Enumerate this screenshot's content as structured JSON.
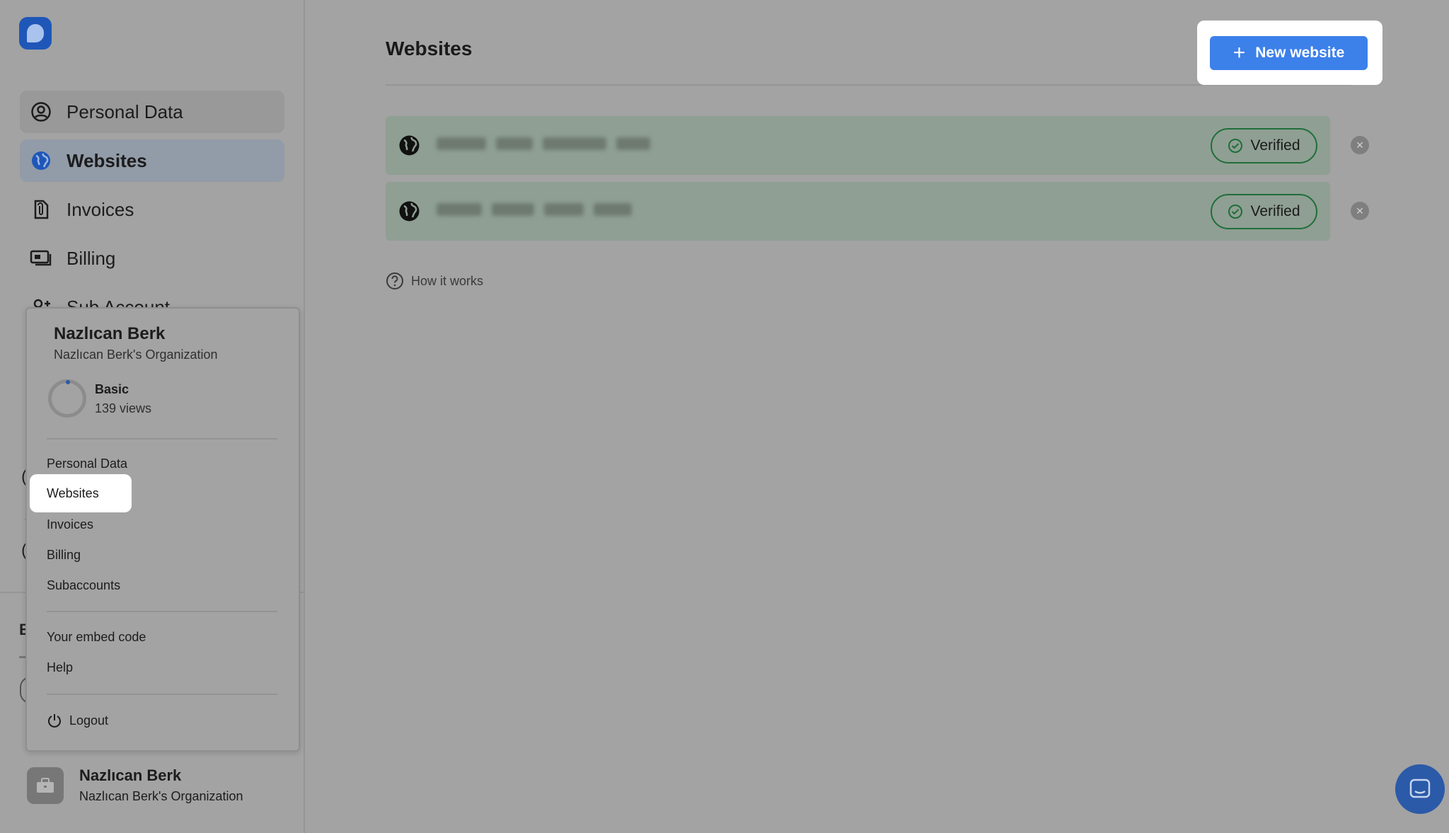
{
  "colors": {
    "accent": "#3c80ea",
    "brand": "#1f57b8",
    "verified": "#1f6e3a",
    "overlay": "#a3a3a3"
  },
  "sidebar": {
    "items": [
      {
        "label": "Personal Data",
        "icon": "user-circle-icon"
      },
      {
        "label": "Websites",
        "icon": "globe-icon",
        "active": true
      },
      {
        "label": "Invoices",
        "icon": "file-clip-icon"
      },
      {
        "label": "Billing",
        "icon": "cash-icon"
      },
      {
        "label": "Sub Account",
        "icon": "user-plus-icon"
      }
    ],
    "partial_b": "B",
    "user": {
      "name": "Nazlıcan Berk",
      "org": "Nazlıcan Berk's Organization"
    }
  },
  "popup": {
    "name": "Nazlıcan Berk",
    "org": "Nazlıcan Berk's Organization",
    "plan": {
      "name": "Basic",
      "views": "139 views"
    },
    "items": [
      "Personal Data",
      "Websites",
      "Invoices",
      "Billing",
      "Subaccounts"
    ],
    "extra": [
      "Your embed code",
      "Help"
    ],
    "logout": "Logout"
  },
  "main": {
    "title": "Websites",
    "new_button": "New website",
    "websites": [
      {
        "status": "Verified"
      },
      {
        "status": "Verified"
      }
    ],
    "how_it_works": "How it works"
  }
}
